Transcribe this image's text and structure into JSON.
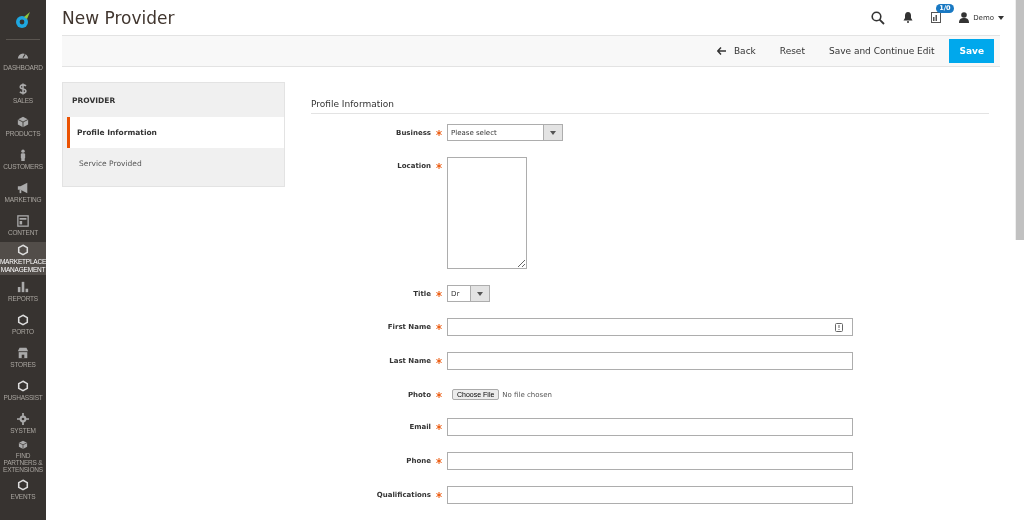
{
  "nav": {
    "items": [
      {
        "label": "DASHBOARD",
        "selected": false
      },
      {
        "label": "SALES",
        "selected": false
      },
      {
        "label": "PRODUCTS",
        "selected": false
      },
      {
        "label": "CUSTOMERS",
        "selected": false
      },
      {
        "label": "MARKETING",
        "selected": false
      },
      {
        "label": "CONTENT",
        "selected": false
      },
      {
        "label": "MARKETPLACE MANAGEMENT",
        "selected": true
      },
      {
        "label": "REPORTS",
        "selected": false
      },
      {
        "label": "PORTO",
        "selected": false
      },
      {
        "label": "STORES",
        "selected": false
      },
      {
        "label": "PUSHASSIST",
        "selected": false
      },
      {
        "label": "SYSTEM",
        "selected": false
      },
      {
        "label": "FIND PARTNERS & EXTENSIONS",
        "selected": false
      },
      {
        "label": "EVENTS",
        "selected": false
      }
    ]
  },
  "header": {
    "title": "New Provider",
    "notification_badge": "1/0",
    "user": "Demo"
  },
  "actions": [
    {
      "label": "Back",
      "kind": "back"
    },
    {
      "label": "Reset",
      "kind": "plain"
    },
    {
      "label": "Save and Continue Edit",
      "kind": "plain"
    },
    {
      "label": "Save",
      "kind": "primary"
    }
  ],
  "side_panel": {
    "heading": "PROVIDER",
    "tabs": [
      {
        "label": "Profile Information",
        "selected": true
      },
      {
        "label": "Service Provided",
        "selected": false
      }
    ]
  },
  "form": {
    "section_title": "Profile Information",
    "fields": [
      {
        "label": "Business",
        "kind": "select",
        "value": "Please select",
        "required": true
      },
      {
        "label": "Location",
        "kind": "textarea",
        "required": true
      },
      {
        "label": "Title",
        "kind": "select",
        "value": "Dr",
        "required": true
      },
      {
        "label": "First Name",
        "kind": "text",
        "required": true
      },
      {
        "label": "Last Name",
        "kind": "text",
        "required": true
      },
      {
        "label": "Photo",
        "kind": "file",
        "button": "Choose File",
        "value": "No file chosen",
        "required": true
      },
      {
        "label": "Email",
        "kind": "text",
        "required": true
      },
      {
        "label": "Phone",
        "kind": "text",
        "required": true
      },
      {
        "label": "Qualifications",
        "kind": "text",
        "required": true
      }
    ]
  }
}
